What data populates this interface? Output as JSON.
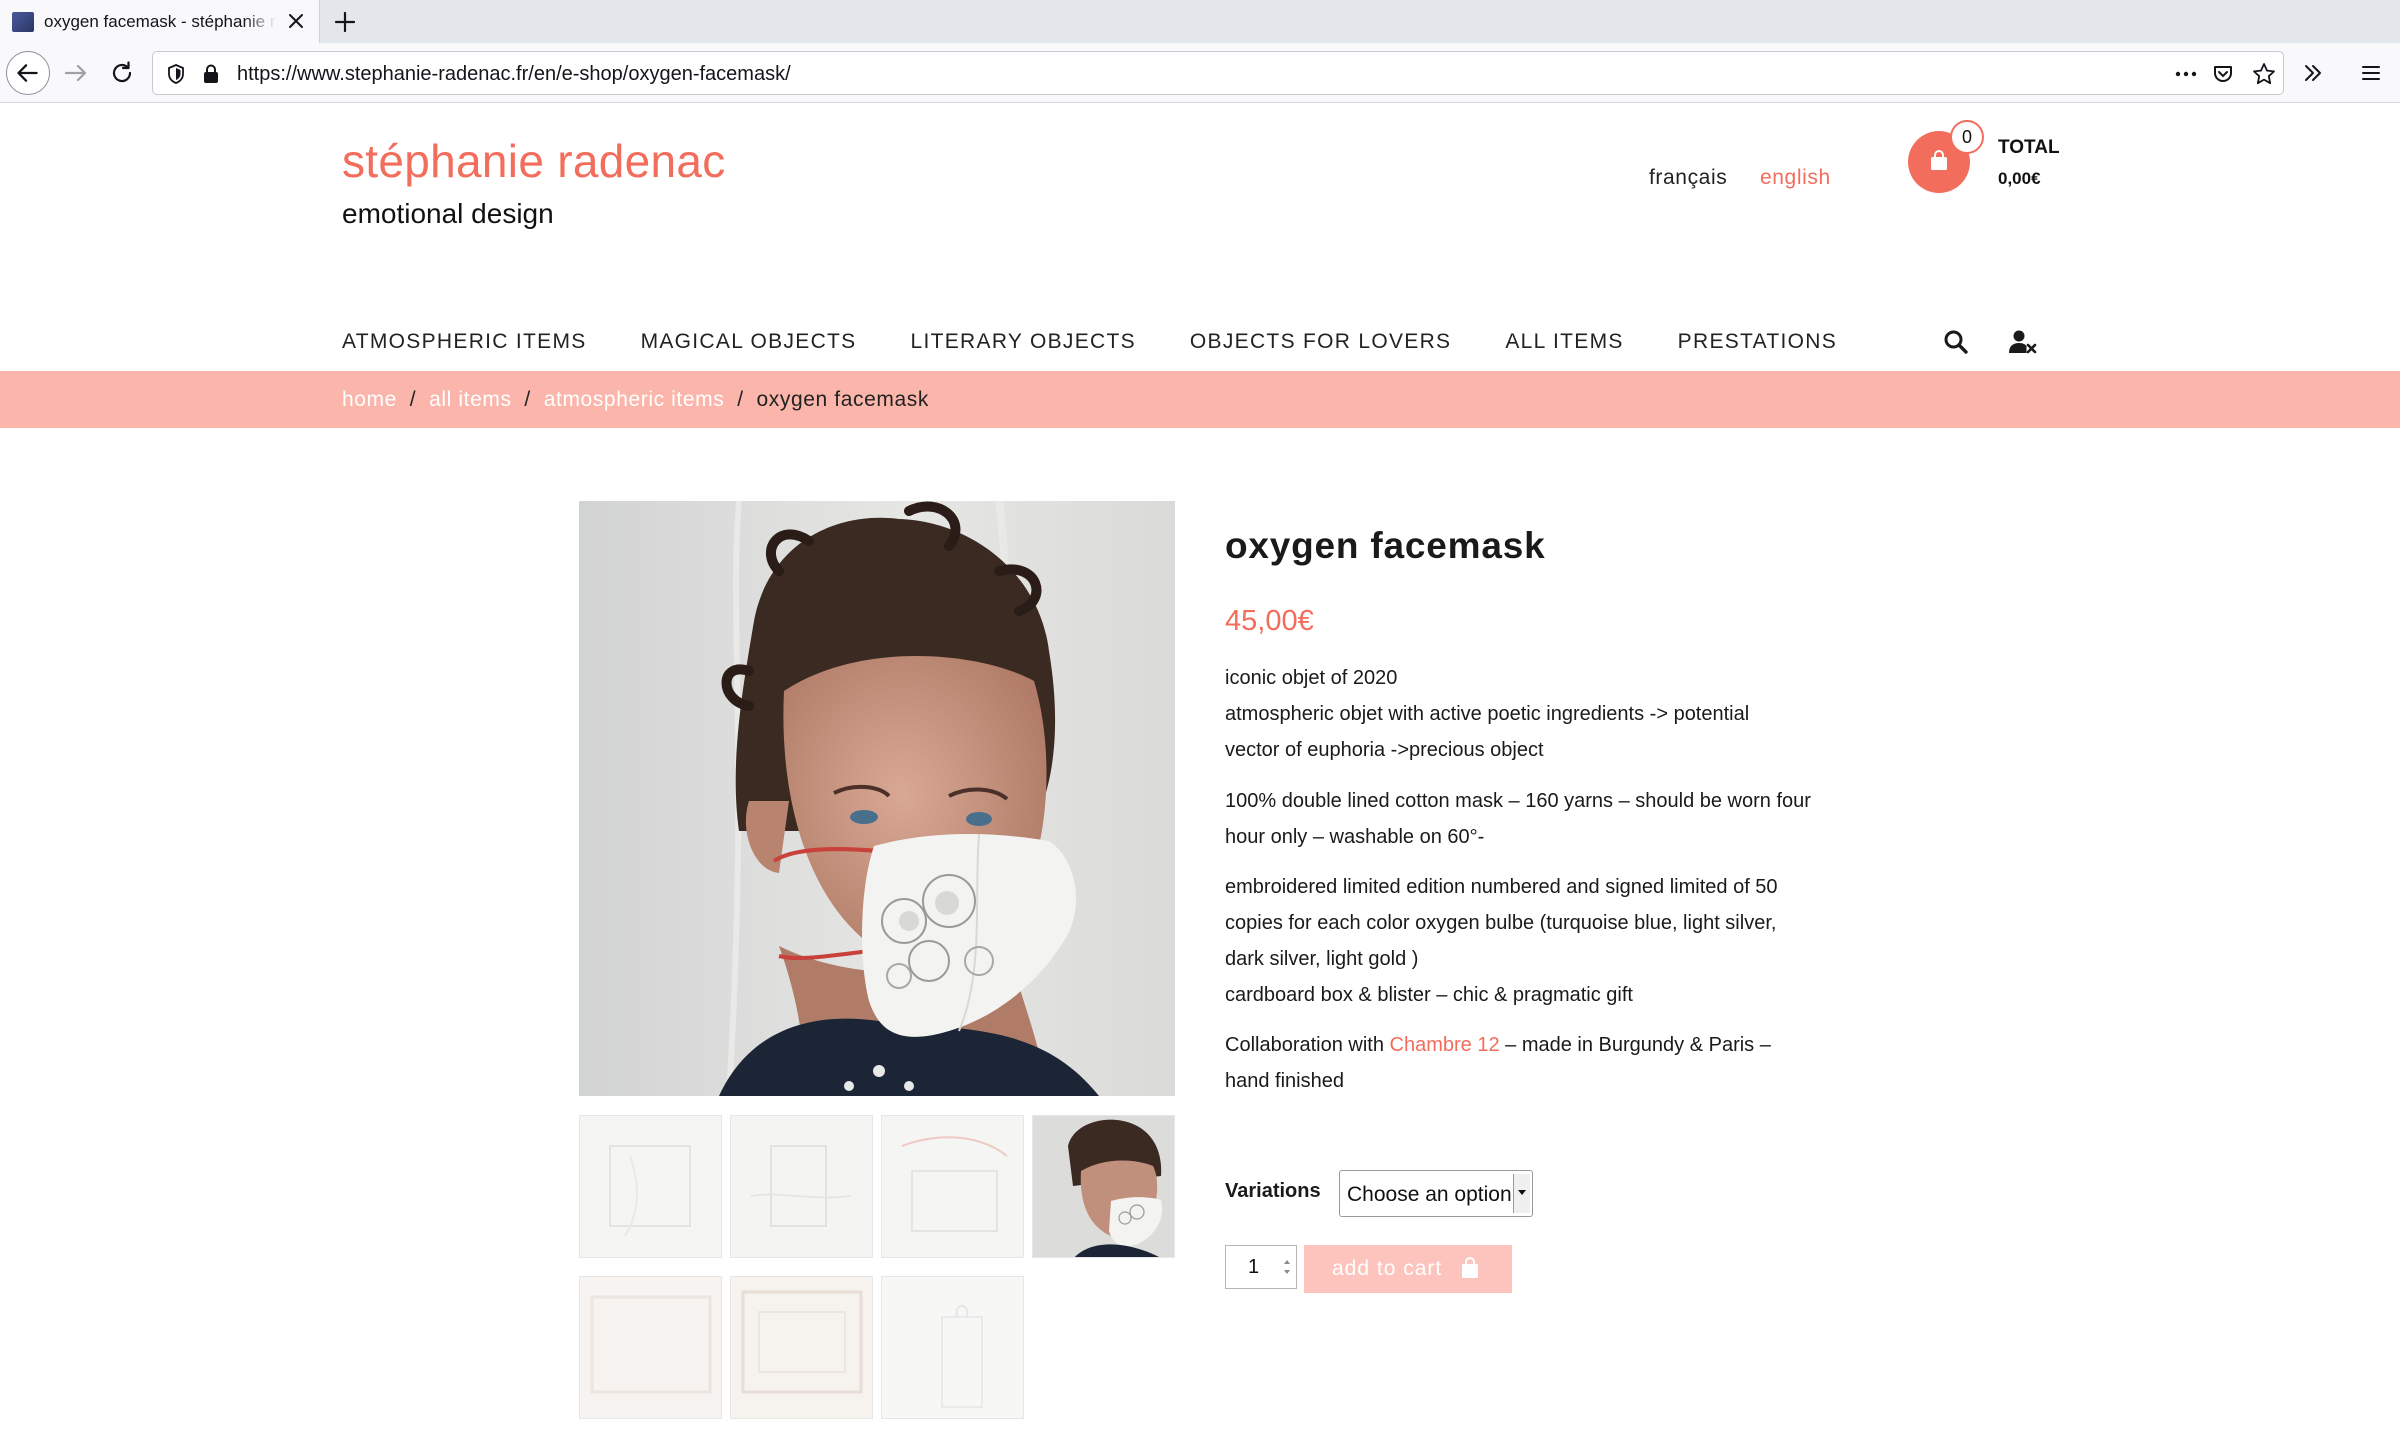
{
  "browser": {
    "tab_title": "oxygen facemask - stéphanie radenac",
    "url": "https://www.stephanie-radenac.fr/en/e-shop/oxygen-facemask/"
  },
  "header": {
    "brand_title": "stéphanie radenac",
    "brand_tagline": "emotional design",
    "languages": [
      "français",
      "english"
    ],
    "active_language": "english",
    "cart": {
      "count": "0",
      "total_label": "TOTAL",
      "total_value": "0,00€"
    }
  },
  "nav": {
    "items": [
      "ATMOSPHERIC ITEMS",
      "MAGICAL OBJECTS",
      "LITERARY OBJECTS",
      "OBJECTS FOR LOVERS",
      "ALL ITEMS",
      "PRESTATIONS"
    ]
  },
  "breadcrumb": {
    "links": [
      "home",
      "all items",
      "atmospheric items"
    ],
    "separator": "/",
    "current": "oxygen facemask"
  },
  "product": {
    "title": "oxygen facemask",
    "price": "45,00€",
    "desc1": [
      "iconic objet of 2020",
      "atmospheric objet with active poetic ingredients  -> potential",
      "vector of euphoria ->precious object"
    ],
    "desc2": [
      "100% double lined cotton mask – 160 yarns – should be worn four",
      "hour only – washable on 60°-"
    ],
    "desc3": [
      "embroidered limited edition numbered and signed limited of 50",
      "copies for each color oxygen bulbe (turquoise blue,  light silver,",
      "dark silver, light gold )",
      "cardboard box & blister – chic & pragmatic gift"
    ],
    "collab_prefix": "Collaboration with ",
    "collab_link": "Chambre 12",
    "collab_suffix": "  – made in Burgundy & Paris  –",
    "collab_line2": "hand finished",
    "variations_label": "Variations",
    "variation_selected": "Choose an option",
    "quantity": "1",
    "add_to_cart_label": "add to cart"
  },
  "colors": {
    "accent": "#f26d5b",
    "breadcrumb_bar": "#fbb5ab",
    "button_disabled": "#fcc4bc"
  }
}
